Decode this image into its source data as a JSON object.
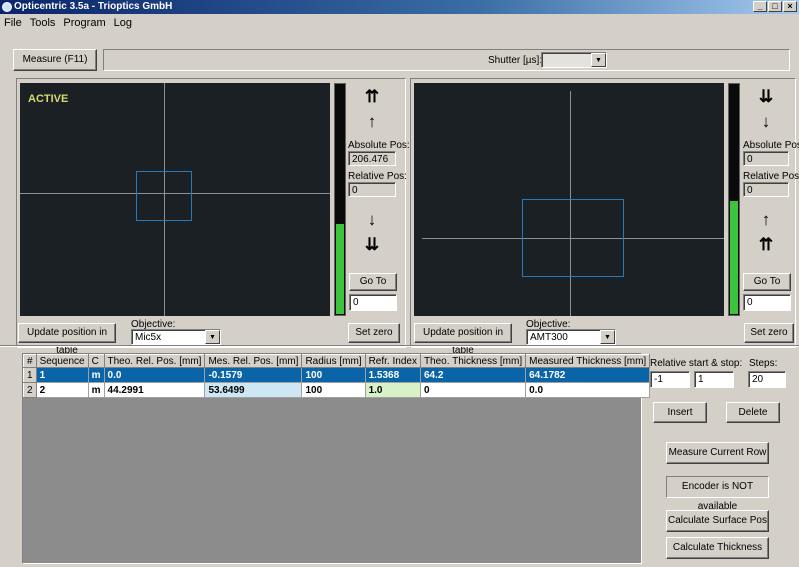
{
  "window": {
    "title": "Opticentric 3.5a - Trioptics GmbH"
  },
  "menu": [
    "File",
    "Tools",
    "Program",
    "Log"
  ],
  "toolbar": {
    "measure_label": "Measure (F11)",
    "shutter_label": "Shutter [µs]:",
    "shutter_value": ""
  },
  "left_panel": {
    "status": "ACTIVE",
    "absolute_pos_label": "Absolute Pos:",
    "absolute_pos_value": "206.476",
    "relative_pos_label": "Relative Pos:",
    "relative_pos_value": "0",
    "goto_label": "Go To",
    "goto_value": "0",
    "update_label": "Update position in table",
    "objective_label": "Objective:",
    "objective_value": "Mic5x",
    "setzero_label": "Set zero",
    "meter_level": 0.4
  },
  "right_panel": {
    "absolute_pos_label": "Absolute Pos:",
    "absolute_pos_value": "0",
    "relative_pos_label": "Relative Pos:",
    "relative_pos_value": "0",
    "goto_label": "Go To",
    "goto_value": "0",
    "update_label": "Update position in table",
    "objective_label": "Objective:",
    "objective_value": "AMT300",
    "setzero_label": "Set zero",
    "meter_level": 0.5
  },
  "table": {
    "headers": [
      "#",
      "Sequence",
      "C",
      "Theo. Rel. Pos. [mm]",
      "Mes. Rel. Pos. [mm]",
      "Radius [mm]",
      "Refr. Index",
      "Theo. Thickness [mm]",
      "Measured Thickness [mm]"
    ],
    "rows": [
      [
        "1",
        "1",
        "m",
        "0.0",
        "-0.1579",
        "100",
        "1.5368",
        "64.2",
        "64.1782"
      ],
      [
        "2",
        "2",
        "m",
        "44.2991",
        "53.6499",
        "100",
        "1.0",
        "0",
        "0.0"
      ]
    ]
  },
  "controls": {
    "rel_label": "Relative start & stop:",
    "rel_start": "-1",
    "rel_stop": "1",
    "steps_label": "Steps:",
    "steps_value": "20",
    "insert_label": "Insert",
    "delete_label": "Delete",
    "measure_row_label": "Measure Current Row",
    "encoder_label": "Encoder is NOT available",
    "calc_surface_label": "Calculate Surface Pos",
    "calc_thickness_label": "Calculate Thickness"
  }
}
